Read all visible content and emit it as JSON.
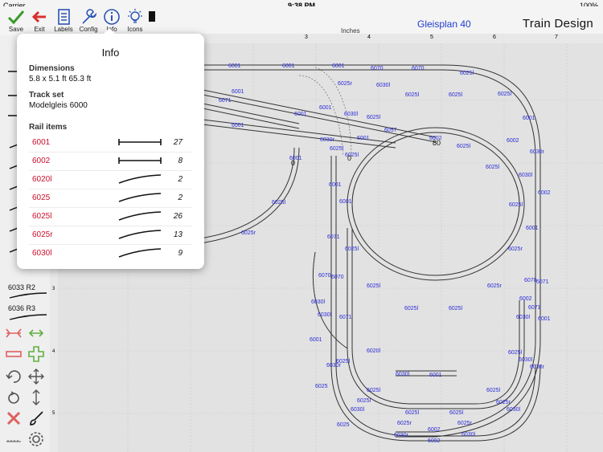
{
  "status": {
    "carrier": "Carrier",
    "time": "9:38 PM",
    "battery": "100%"
  },
  "toolbar": {
    "buttons": [
      {
        "label": "Save",
        "icon": "checkmark-icon"
      },
      {
        "label": "Exit",
        "icon": "exit-arrow-icon"
      },
      {
        "label": "Labels",
        "icon": "document-icon"
      },
      {
        "label": "Config",
        "icon": "wrench-icon"
      },
      {
        "label": "Info",
        "icon": "info-icon"
      },
      {
        "label": "Icons",
        "icon": "lightbulb-icon"
      }
    ],
    "plan_title": "Gleisplan 40",
    "app_title": "Train Design"
  },
  "ruler": {
    "unit": "Inches",
    "top_ticks": [
      "3",
      "4",
      "5",
      "6",
      "7"
    ],
    "left_ticks": [
      "3",
      "4",
      "5"
    ]
  },
  "palette": {
    "items": [
      "6033 R2",
      "6036 R3"
    ]
  },
  "info": {
    "title": "Info",
    "dimensions_label": "Dimensions",
    "dimensions_value": "5.8 x 5.1 ft  65.3 ft",
    "trackset_label": "Track set",
    "trackset_value": "Modelgleis 6000",
    "rail_items_label": "Rail items",
    "rail_items": [
      {
        "name": "6001",
        "count": "27",
        "shape": "straight"
      },
      {
        "name": "6002",
        "count": "8",
        "shape": "straight"
      },
      {
        "name": "6020l",
        "count": "2",
        "shape": "curve"
      },
      {
        "name": "6025",
        "count": "2",
        "shape": "curve"
      },
      {
        "name": "6025l",
        "count": "26",
        "shape": "curve"
      },
      {
        "name": "6025r",
        "count": "13",
        "shape": "curve"
      },
      {
        "name": "6030l",
        "count": "9",
        "shape": "curve"
      }
    ]
  },
  "track_labels": [
    "6001",
    "6070",
    "6025r",
    "6030l",
    "6025l",
    "6071",
    "6002",
    "6057",
    "6030r",
    "6020l",
    "6025",
    "80",
    "0"
  ],
  "colors": {
    "track_label": "#2a2ad8",
    "rail_name": "#c8102e",
    "plan_title": "#1f3fd0",
    "canvas": "#e2e2e2"
  }
}
